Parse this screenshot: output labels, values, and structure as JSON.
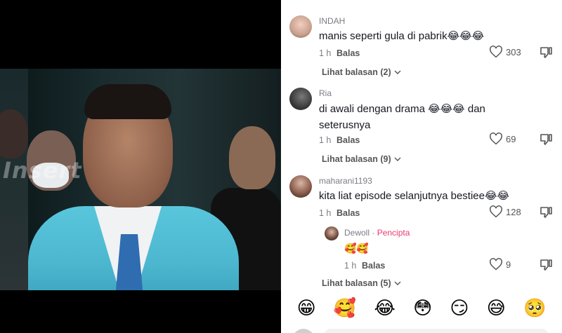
{
  "video": {
    "watermark": "Insert"
  },
  "comments": [
    {
      "username": "INDAH",
      "text": "manis seperti gula di pabrik😂😂😂",
      "time": "1 h",
      "reply_label": "Balas",
      "likes": "303",
      "view_replies": "Lihat balasan (2)"
    },
    {
      "username": "Ria",
      "text": "di awali dengan drama 😂😂😂 dan",
      "text2": "seterusnya",
      "time": "1 h",
      "reply_label": "Balas",
      "likes": "69",
      "view_replies": "Lihat balasan (9)"
    },
    {
      "username": "maharani1193",
      "text": "kita liat episode selanjutnya bestiee😂😂",
      "time": "1 h",
      "reply_label": "Balas",
      "likes": "128",
      "view_replies": "Lihat balasan (5)"
    }
  ],
  "reply": {
    "username": "Dewoll",
    "badge": "Pencipta",
    "text": "🥰🥰",
    "time": "1 h",
    "reply_label": "Balas",
    "likes": "9"
  },
  "emoji_bar": [
    "😁",
    "🥰",
    "😂",
    "😳",
    "😏",
    "😅",
    "🥺"
  ],
  "colors": {
    "creator_badge": "#e93a6e",
    "suit": "#4cb6cf",
    "text": "#161823",
    "muted": "#7b7d85"
  }
}
